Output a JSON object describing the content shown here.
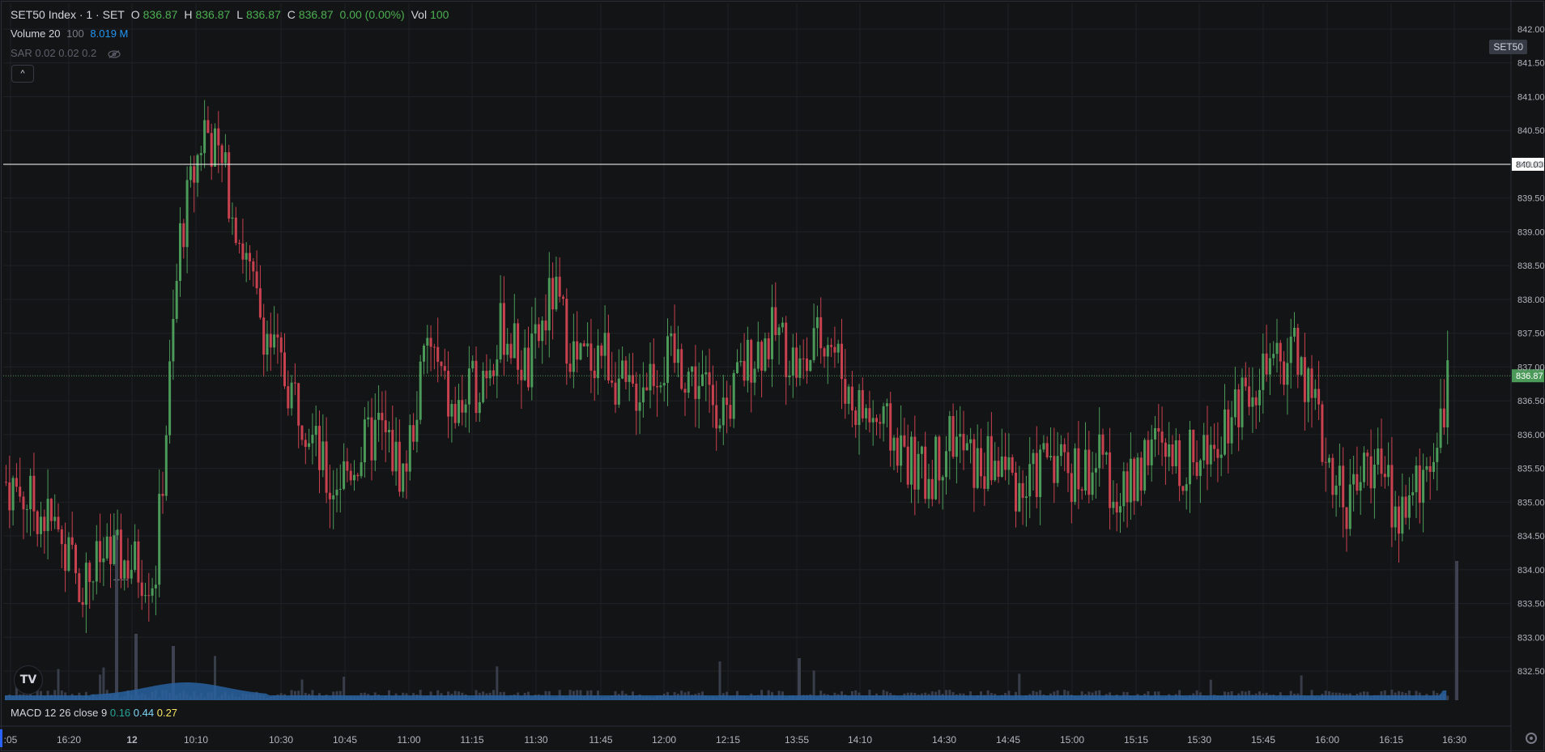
{
  "legend": {
    "title": "SET50 Index · 1 · SET",
    "o_label": "O",
    "o_value": "836.87",
    "h_label": "H",
    "h_value": "836.87",
    "l_label": "L",
    "l_value": "836.87",
    "c_label": "C",
    "c_value": "836.87",
    "change": "0.00 (0.00%)",
    "vol_label": "Vol",
    "vol_value": "100"
  },
  "volume_indicator": {
    "name": "Volume 20",
    "param": "100",
    "value": "8.019 M"
  },
  "sar_indicator": {
    "text": "SAR 0.02 0.02 0.2",
    "icon": "eye-off-icon"
  },
  "collapse_button": {
    "label": "^"
  },
  "symbol_badge": "SET50",
  "macd": {
    "name": "MACD 12 26 close 9",
    "v1": "0.16",
    "v2": "0.44",
    "v3": "0.27"
  },
  "logo": "TV",
  "colors": {
    "background": "#131416",
    "up": "#4c9a5a",
    "down": "#c8414f",
    "volume_area": "#2962a0",
    "grid": "#1e2127",
    "axis_text": "#b2b5be",
    "horizontal_line": "#ffffff",
    "current_price_bg": "#4c9a5a",
    "macd_v1": "#26a69a",
    "macd_v2": "#7fd6f7",
    "macd_v3": "#f5e663"
  },
  "chart_data": {
    "type": "candlestick",
    "y_axis": {
      "min": 832.25,
      "max": 842.25,
      "ticks": [
        "842.00",
        "841.50",
        "841.00",
        "840.50",
        "840.00",
        "839.50",
        "839.00",
        "838.50",
        "838.00",
        "837.50",
        "837.00",
        "836.50",
        "836.00",
        "835.50",
        "835.00",
        "834.50",
        "834.00",
        "833.50",
        "833.00",
        "832.50"
      ]
    },
    "x_axis_ticks": [
      ":05",
      "16:20",
      "12",
      "10:10",
      "10:30",
      "10:45",
      "11:00",
      "11:15",
      "11:30",
      "11:45",
      "12:00",
      "12:15",
      "13:55",
      "14:10",
      "14:30",
      "14:45",
      "15:00",
      "15:15",
      "15:30",
      "15:45",
      "16:00",
      "16:15",
      "16:30"
    ],
    "horizontal_line": {
      "price": 840.0,
      "label": "840.00"
    },
    "current_price": {
      "price": 836.87,
      "label": "836.87"
    },
    "price_path": [
      835.3,
      835.0,
      834.6,
      833.8,
      834.2,
      834.1,
      833.9,
      838.9,
      840.6,
      839.6,
      838.0,
      837.0,
      836.3,
      835.2,
      835.6,
      836.1,
      835.4,
      837.4,
      836.2,
      836.8,
      837.6,
      836.9,
      838.1,
      837.0,
      837.3,
      836.5,
      837.0,
      837.1,
      836.7,
      836.4,
      837.2,
      837.5,
      836.9,
      837.6,
      836.5,
      836.2,
      835.8,
      835.3,
      836.0,
      835.5,
      835.6,
      835.1,
      835.8,
      835.4,
      835.6,
      835.0,
      835.9,
      835.5,
      835.7,
      836.2,
      836.8,
      836.9,
      837.3,
      835.8,
      835.0,
      835.7,
      834.8,
      835.3,
      836.7
    ],
    "grid": true
  }
}
